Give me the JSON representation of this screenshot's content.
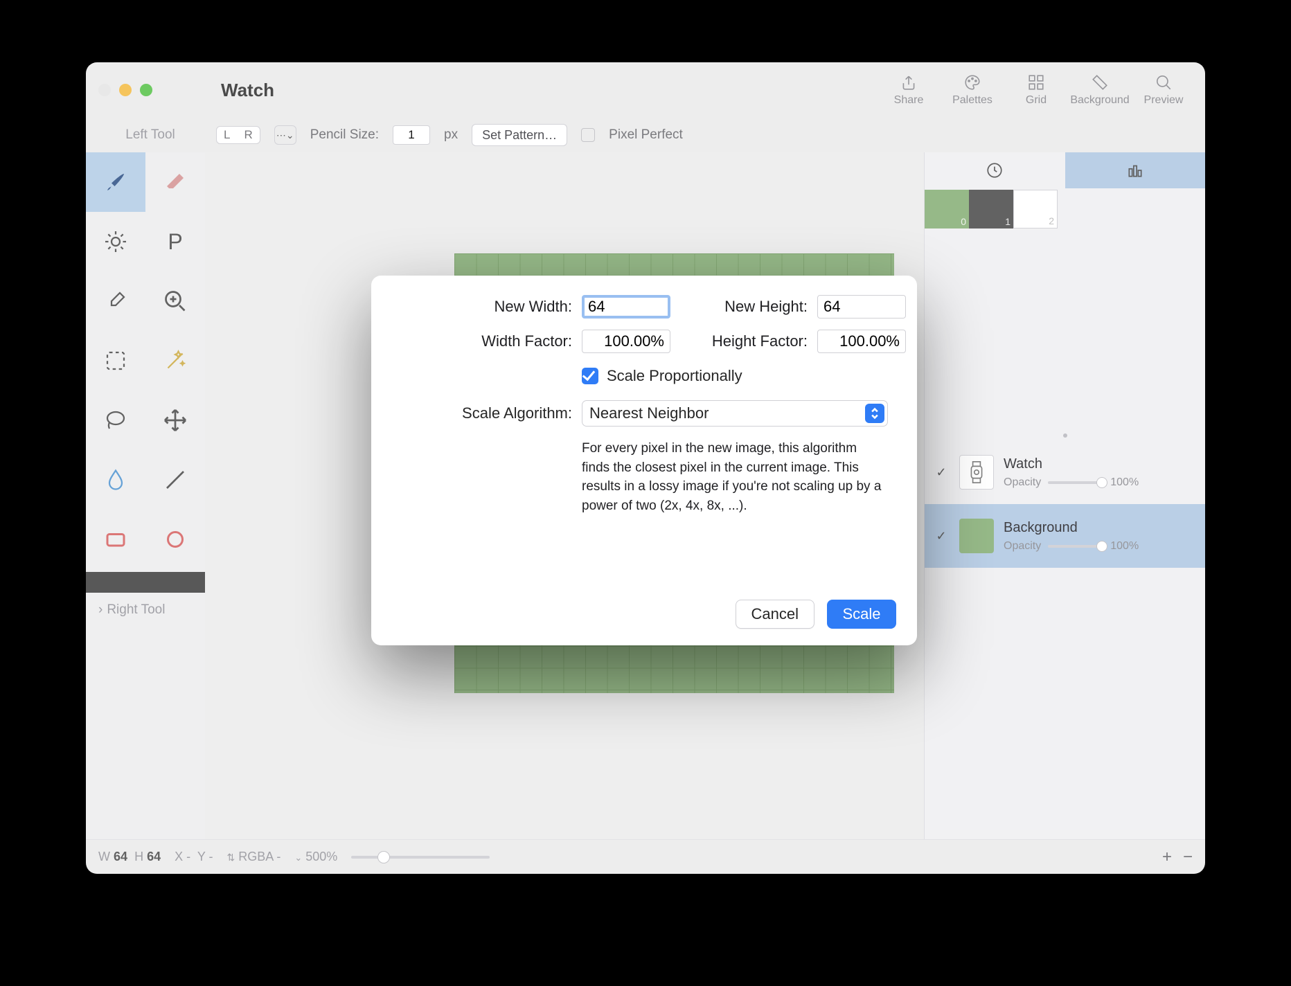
{
  "window": {
    "title": "Watch"
  },
  "toolbar_labels": {
    "left_tool": "Left Tool",
    "right_tool": "Right Tool"
  },
  "secondbar": {
    "L": "L",
    "R": "R",
    "dropdown": "⋯⌄",
    "pencil_label": "Pencil Size:",
    "pencil_value": "1",
    "px": "px",
    "set_pattern": "Set Pattern…",
    "pixel_perfect": "Pixel Perfect"
  },
  "rightbar": [
    {
      "label": "Share",
      "icon": "share-icon"
    },
    {
      "label": "Palettes",
      "icon": "palette-icon"
    },
    {
      "label": "Grid",
      "icon": "grid-icon"
    },
    {
      "label": "Background",
      "icon": "background-icon"
    },
    {
      "label": "Preview",
      "icon": "preview-icon"
    }
  ],
  "swatches": [
    {
      "idx": "0",
      "color": "#8eb37e"
    },
    {
      "idx": "1",
      "color": "#555555"
    },
    {
      "idx": "2",
      "color": "#ffffff"
    }
  ],
  "layers": [
    {
      "name": "Watch",
      "opacity_label": "Opacity",
      "opacity": "100%"
    },
    {
      "name": "Background",
      "opacity_label": "Opacity",
      "opacity": "100%"
    }
  ],
  "status": {
    "w": "W",
    "wv": "64",
    "h": "H",
    "hv": "64",
    "x": "X",
    "xv": "-",
    "y": "Y",
    "yv": "-",
    "rgba": "RGBA",
    "dash": "-",
    "zoom": "500%",
    "updown": "⌃"
  },
  "dialog": {
    "new_width_label": "New Width:",
    "new_width": "64",
    "new_height_label": "New Height:",
    "new_height": "64",
    "width_factor_label": "Width Factor:",
    "width_factor": "100.00%",
    "height_factor_label": "Height Factor:",
    "height_factor": "100.00%",
    "scale_prop": "Scale Proportionally",
    "algo_label": "Scale Algorithm:",
    "algo_value": "Nearest Neighbor",
    "desc": "For every pixel in the new image, this algorithm finds the closest pixel in the current image. This results in a lossy image if you're not scaling up by a power of two (2x, 4x, 8x, ...).",
    "cancel": "Cancel",
    "scale": "Scale"
  }
}
